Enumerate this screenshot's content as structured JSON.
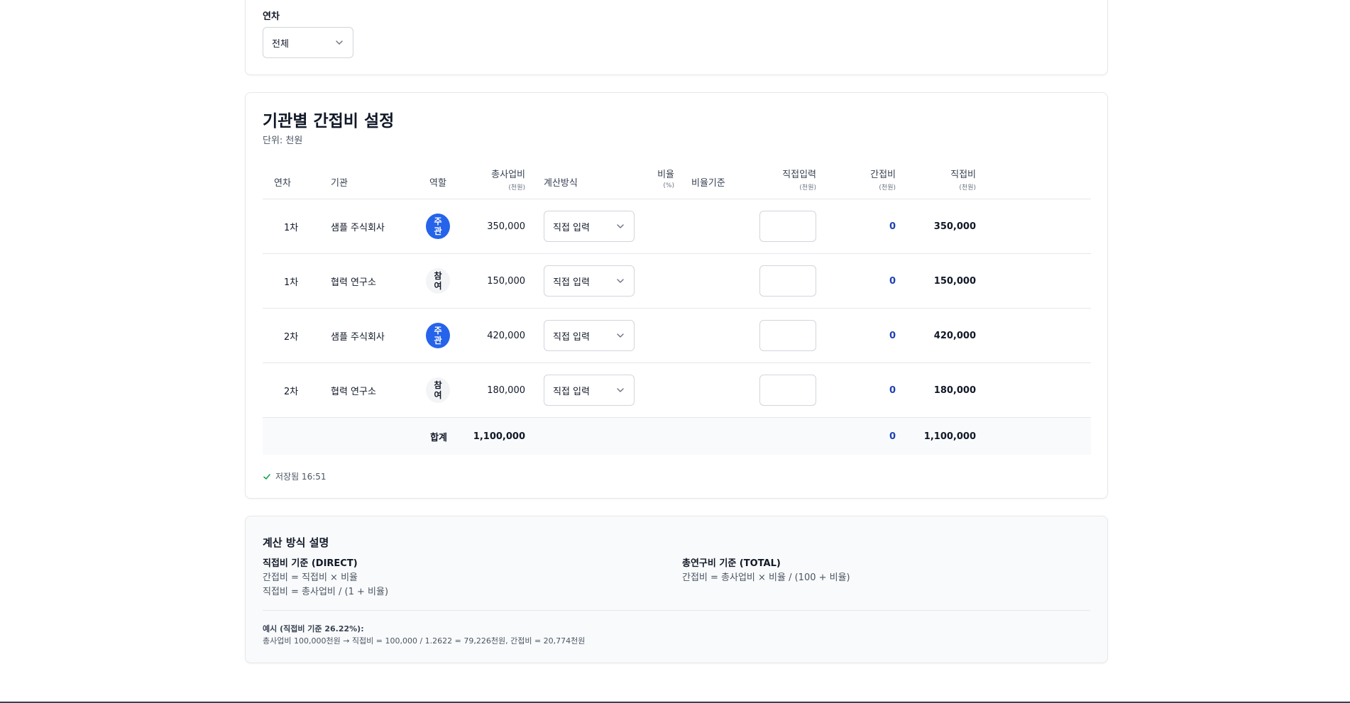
{
  "filter": {
    "label": "연차",
    "selected": "전체"
  },
  "section": {
    "title": "기관별 간접비 설정",
    "unit": "단위: 천원"
  },
  "table": {
    "headers": {
      "year": "연차",
      "org": "기관",
      "role": "역할",
      "total_cost": "총사업비",
      "total_cost_unit": "(천원)",
      "method": "계산방식",
      "rate": "비율",
      "rate_unit": "(%)",
      "rate_basis": "비율기준",
      "direct_input": "직접입력",
      "direct_input_unit": "(천원)",
      "indirect": "간접비",
      "indirect_unit": "(천원)",
      "direct": "직접비",
      "direct_unit": "(천원)"
    },
    "rows": [
      {
        "year": "1차",
        "org": "샘플 주식회사",
        "role_top": "주",
        "role_bottom": "관",
        "role_type": "lead",
        "total_cost": "350,000",
        "method": "직접 입력",
        "rate": "",
        "rate_basis": "",
        "direct_input": "",
        "indirect": "0",
        "direct": "350,000"
      },
      {
        "year": "1차",
        "org": "협력 연구소",
        "role_top": "참",
        "role_bottom": "여",
        "role_type": "participant",
        "total_cost": "150,000",
        "method": "직접 입력",
        "rate": "",
        "rate_basis": "",
        "direct_input": "",
        "indirect": "0",
        "direct": "150,000"
      },
      {
        "year": "2차",
        "org": "샘플 주식회사",
        "role_top": "주",
        "role_bottom": "관",
        "role_type": "lead",
        "total_cost": "420,000",
        "method": "직접 입력",
        "rate": "",
        "rate_basis": "",
        "direct_input": "",
        "indirect": "0",
        "direct": "420,000"
      },
      {
        "year": "2차",
        "org": "협력 연구소",
        "role_top": "참",
        "role_bottom": "여",
        "role_type": "participant",
        "total_cost": "180,000",
        "method": "직접 입력",
        "rate": "",
        "rate_basis": "",
        "direct_input": "",
        "indirect": "0",
        "direct": "180,000"
      }
    ],
    "total": {
      "label": "합계",
      "total_cost": "1,100,000",
      "indirect": "0",
      "direct": "1,100,000"
    }
  },
  "status": {
    "saved_text": "저장됨 16:51",
    "icon": "check-icon"
  },
  "explanation": {
    "title": "계산 방식 설명",
    "direct_basis": {
      "heading": "직접비 기준 (DIRECT)",
      "line1": "간접비 = 직접비 × 비율",
      "line2": "직접비 = 총사업비 / (1 + 비율)"
    },
    "total_basis": {
      "heading": "총연구비 기준 (TOTAL)",
      "line1": "간접비 = 총사업비 × 비율 / (100 + 비율)"
    },
    "example": {
      "heading": "예시 (직접비 기준 26.22%):",
      "text": "총사업비 100,000천원 → 직접비 = 100,000 / 1.2622 = 79,226천원, 간접비 = 20,774천원"
    }
  },
  "colors": {
    "accent": "#2563eb",
    "number_link": "#1e40af",
    "border": "#e5e7eb"
  }
}
